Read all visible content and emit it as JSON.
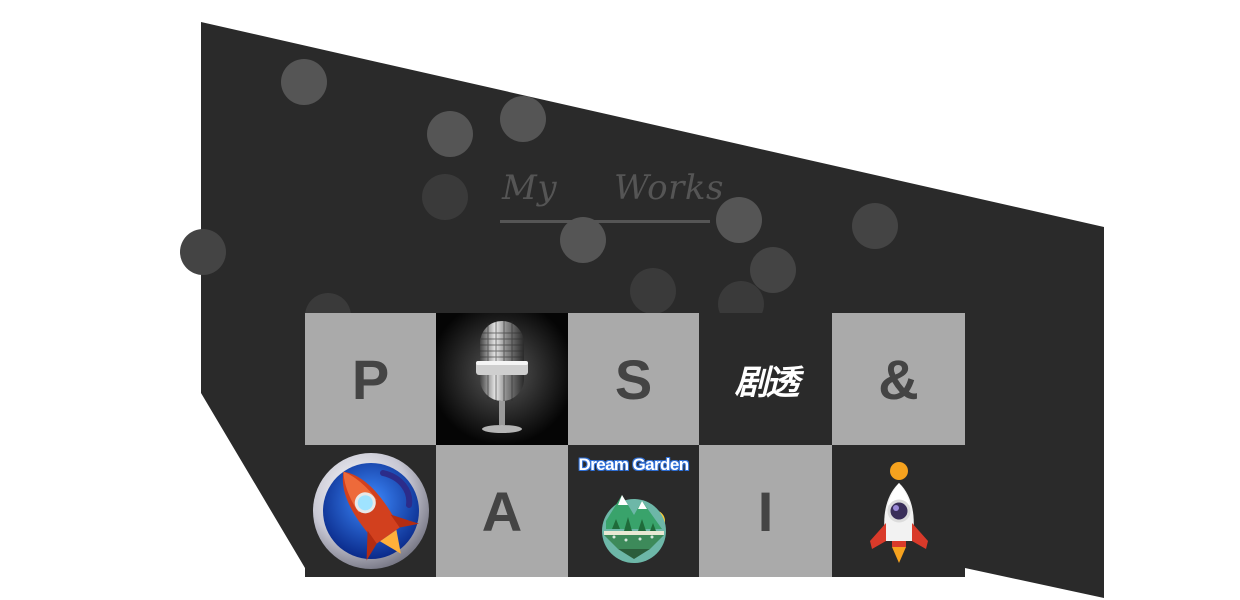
{
  "heading": {
    "word1": "My",
    "word2": "Works"
  },
  "tiles": [
    {
      "type": "letter",
      "text": "P",
      "name": "tile-p"
    },
    {
      "type": "icon",
      "icon": "microphone-icon",
      "name": "tile-microphone"
    },
    {
      "type": "letter",
      "text": "S",
      "name": "tile-s"
    },
    {
      "type": "logo",
      "text": "剧透",
      "name": "tile-jutou-logo"
    },
    {
      "type": "letter",
      "text": "&",
      "name": "tile-ampersand"
    },
    {
      "type": "icon",
      "icon": "rocket-circle-icon",
      "name": "tile-rocket-circle"
    },
    {
      "type": "letter",
      "text": "A",
      "name": "tile-a"
    },
    {
      "type": "logo",
      "text": "Dream Garden",
      "icon": "dream-garden-island-icon",
      "name": "tile-dream-garden"
    },
    {
      "type": "letter",
      "text": "I",
      "name": "tile-i"
    },
    {
      "type": "icon",
      "icon": "rocket-icon",
      "name": "tile-rocket"
    }
  ],
  "colors": {
    "panel": "#2a2a2a",
    "tile_light": "#aaaaaa",
    "letter": "#444444",
    "heading": "#555555"
  }
}
